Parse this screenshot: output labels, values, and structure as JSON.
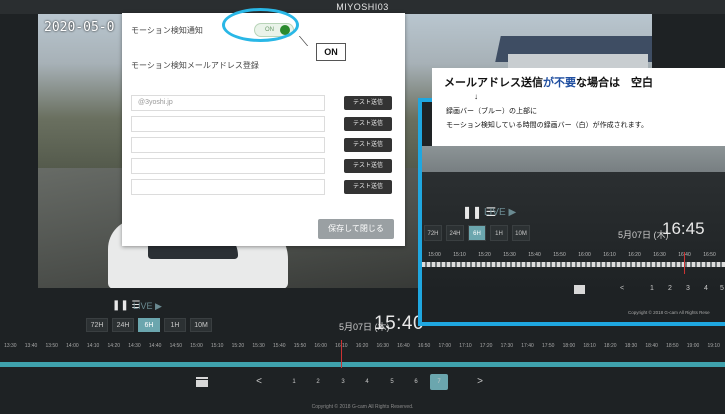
{
  "window": {
    "title": "MIYOSHI03"
  },
  "video": {
    "timestamp": "2020-05-0"
  },
  "controls": {
    "live_label": "LIVE ▶",
    "ranges": [
      "72H",
      "24H",
      "6H",
      "1H",
      "10M"
    ],
    "active_range": "6H",
    "date": "5月07日 (木)",
    "time": "15:40"
  },
  "timeline": {
    "ticks": [
      "13:30",
      "13:40",
      "13:50",
      "14:00",
      "14:10",
      "14:20",
      "14:30",
      "14:40",
      "14:50",
      "15:00",
      "15:10",
      "15:20",
      "15:30",
      "15:40",
      "15:50",
      "16:00",
      "16:10",
      "16:20",
      "16:30",
      "16:40",
      "16:50",
      "17:00",
      "17:10",
      "17:20",
      "17:30",
      "17:40",
      "17:50",
      "18:00",
      "18:10",
      "18:20",
      "18:30",
      "18:40",
      "18:50",
      "19:00",
      "19:10"
    ]
  },
  "pager": {
    "prev": "<",
    "next": ">",
    "pages": [
      "1",
      "2",
      "3",
      "4",
      "5",
      "6",
      "7"
    ],
    "active": "7"
  },
  "footer": {
    "copyright": "Copyright © 2018 G-cam All Rights Reserved."
  },
  "modal": {
    "notify_label": "モーション検知通知",
    "toggle_label": "ON",
    "email_section_label": "モーション検知メールアドレス登録",
    "emails": [
      {
        "value": "@3yoshi.jp",
        "test_label": "テスト送信"
      },
      {
        "value": "",
        "test_label": "テスト送信"
      },
      {
        "value": "",
        "test_label": "テスト送信"
      },
      {
        "value": "",
        "test_label": "テスト送信"
      },
      {
        "value": "",
        "test_label": "テスト送信"
      }
    ],
    "save_label": "保存して閉じる"
  },
  "callout": {
    "on_label": "ON"
  },
  "annotation": {
    "line1_a": "メールアドレス送信",
    "line1_b": "が不要",
    "line1_c": "な場合は　空白",
    "arrow": "↓",
    "line2": "録画バー（ブルー）の上部に",
    "line3": "モーション検知している時間の録画バー（白）が作成されます。"
  },
  "zoom": {
    "live_label": "LIVE ▶",
    "ranges": [
      "72H",
      "24H",
      "6H",
      "1H",
      "10M"
    ],
    "active_range": "6H",
    "date": "5月07日 (木)",
    "time": "16:45",
    "ticks": [
      "15:00",
      "15:10",
      "15:20",
      "15:30",
      "15:40",
      "15:50",
      "16:00",
      "16:10",
      "16:20",
      "16:30",
      "16:40",
      "16:50"
    ],
    "pages": [
      "<",
      "1",
      "2",
      "3",
      "4",
      "5"
    ],
    "copyright": "Copyright © 2018 G-cam All Rights Rese"
  },
  "colors": {
    "accent": "#6ba6ae",
    "highlight": "#29b7e6",
    "toggle_on": "#2b8a2e"
  }
}
